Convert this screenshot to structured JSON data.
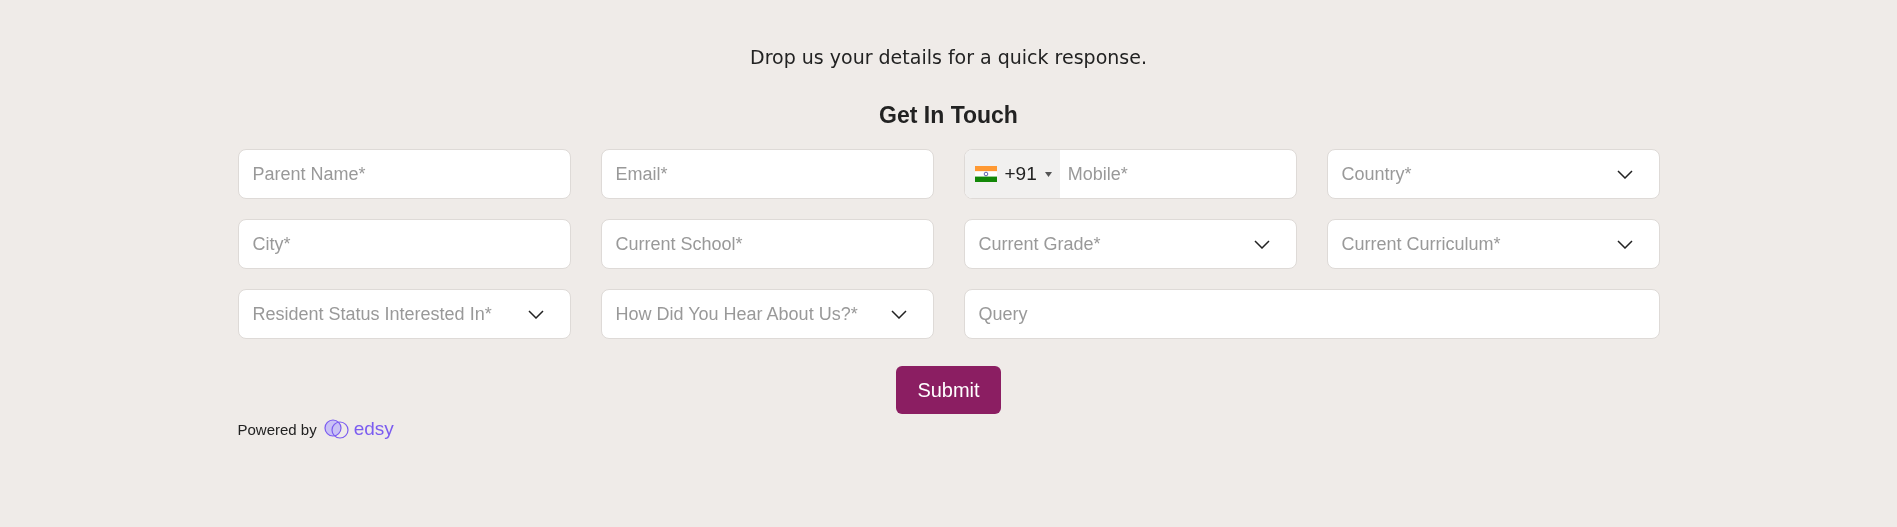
{
  "intro": "Drop us your details for a quick response.",
  "heading": "Get In Touch",
  "fields": [
    {
      "kind": "text",
      "placeholder": "Parent Name*"
    },
    {
      "kind": "text",
      "placeholder": "Email*"
    },
    {
      "kind": "phone",
      "code": "+91",
      "placeholder": "Mobile*"
    },
    {
      "kind": "select",
      "placeholder": "Country*"
    },
    {
      "kind": "text",
      "placeholder": "City*"
    },
    {
      "kind": "text",
      "placeholder": "Current School*"
    },
    {
      "kind": "select",
      "placeholder": "Current Grade*"
    },
    {
      "kind": "select",
      "placeholder": "Current Curriculum*"
    },
    {
      "kind": "select",
      "placeholder": "Resident Status Interested In*"
    },
    {
      "kind": "select",
      "placeholder": "How Did You Hear About Us?*"
    },
    {
      "kind": "text",
      "placeholder": "Query",
      "wide": true
    }
  ],
  "submit": "Submit",
  "powered_by": {
    "label": "Powered by",
    "brand": "edsy"
  }
}
